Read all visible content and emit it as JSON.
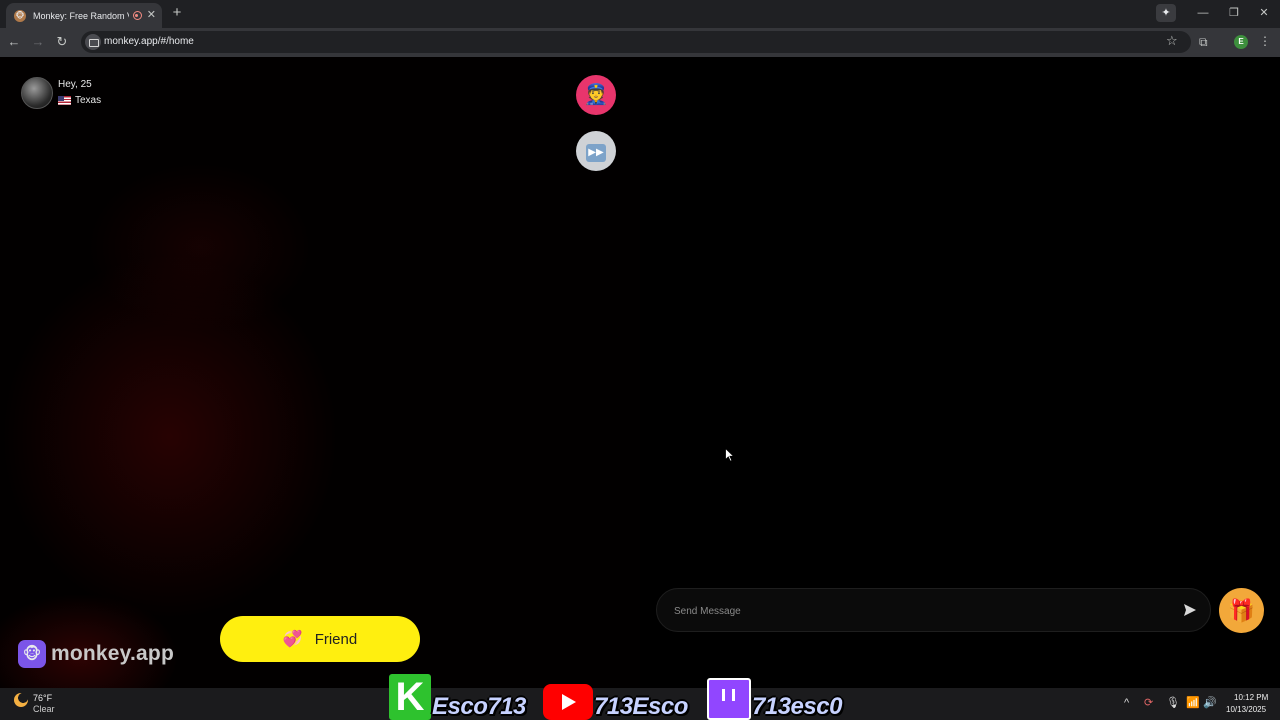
{
  "browser": {
    "tab": {
      "title": "Monkey: Free Random Vide",
      "favicon": "monkey-icon"
    },
    "url": "monkey.app/#/home"
  },
  "page": {
    "user": {
      "greeting": "Hey, 25",
      "location": "Texas",
      "flag": "us-flag-icon"
    },
    "report_icon": "police-officer-icon",
    "skip_icon": "next-track-icon",
    "friend_button": {
      "label": "Friend",
      "icon": "heart-icon",
      "color": "#ffef0f"
    },
    "brand": {
      "name": "monkey.app",
      "logo_color": "#7b55e8"
    },
    "message": {
      "placeholder": "Send Message"
    },
    "gift_icon": "gift-icon"
  },
  "taskbar": {
    "weather": {
      "temp": "76°F",
      "condition": "Clear"
    },
    "overlay": {
      "k_letter": "K",
      "text1": "Esco713",
      "text2": "713Esco",
      "text3": "713esc0"
    },
    "clock": {
      "time": "10:12 PM",
      "date": "10/13/2025"
    }
  }
}
